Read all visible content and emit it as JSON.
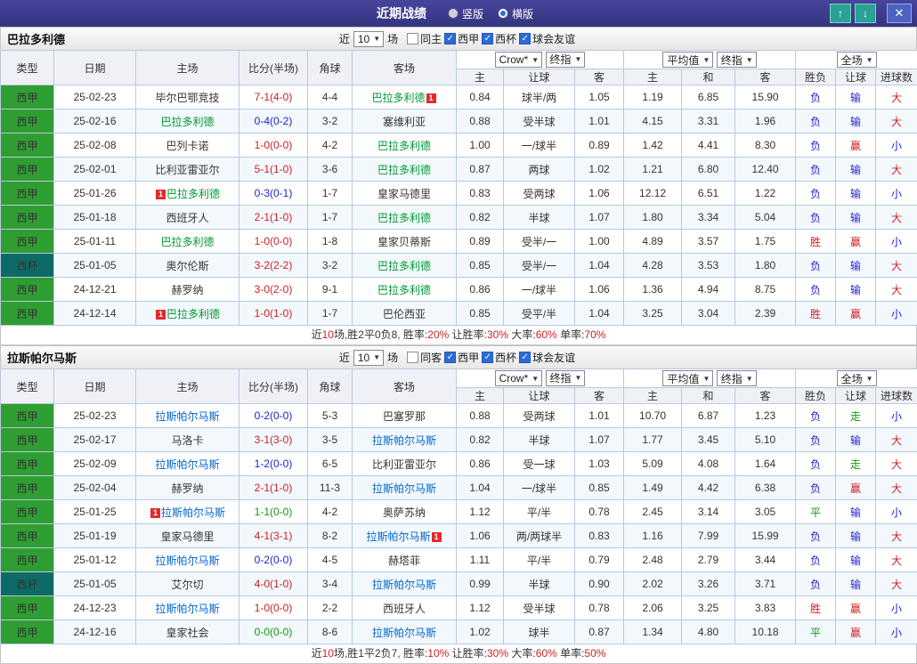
{
  "header": {
    "title": "近期战绩",
    "view_options": [
      {
        "label": "竖版",
        "checked": false
      },
      {
        "label": "横版",
        "checked": true
      }
    ],
    "up_icon": "↑",
    "down_icon": "↓",
    "close_icon": "✕"
  },
  "filter": {
    "prefix": "近",
    "count": "10",
    "suffix": "场"
  },
  "selects": {
    "bookmaker": "Crow*",
    "final": "终指",
    "average": "平均值",
    "scope": "全场"
  },
  "columns": {
    "type": "类型",
    "date": "日期",
    "home": "主场",
    "score": "比分(半场)",
    "corner": "角球",
    "away": "客场",
    "odds_home": "主",
    "odds_line": "让球",
    "odds_away": "客",
    "avg_home": "主",
    "avg_draw": "和",
    "avg_away": "客",
    "result": "胜负",
    "handicap": "让球",
    "goals": "进球数"
  },
  "badge": "1",
  "palette": {
    "r": "#cc2222",
    "b": "#2222cc",
    "g": "#119911",
    "k": "#333333"
  },
  "char_colors": {
    "胜": "r",
    "负": "b",
    "平": "g",
    "赢": "r",
    "输": "b",
    "走": "g",
    "大": "r",
    "小": "b"
  },
  "league_colors": {
    "西甲": "#2f9e32",
    "西杯": "#0d6b66"
  },
  "sections": [
    {
      "team": "巴拉多利德",
      "team_color": "#009933",
      "filters": [
        {
          "label": "同主",
          "checked": false
        },
        {
          "label": "西甲",
          "checked": true
        },
        {
          "label": "西杯",
          "checked": true
        },
        {
          "label": "球会友谊",
          "checked": true
        }
      ],
      "rows": [
        {
          "lg": "西甲",
          "date": "25-02-23",
          "home": "毕尔巴鄂竞技",
          "hf": false,
          "hb": false,
          "score": "7-1(4-0)",
          "sc": "r",
          "cn": "4-4",
          "away": "巴拉多利德",
          "af": true,
          "ab": true,
          "o1": "0.84",
          "ln": "球半/两",
          "o2": "1.05",
          "m1": "1.19",
          "m2": "6.85",
          "m3": "15.90",
          "rs": "负",
          "rh": "输",
          "rg": "大"
        },
        {
          "lg": "西甲",
          "date": "25-02-16",
          "home": "巴拉多利德",
          "hf": true,
          "hb": false,
          "score": "0-4(0-2)",
          "sc": "b",
          "cn": "3-2",
          "away": "塞维利亚",
          "af": false,
          "ab": false,
          "o1": "0.88",
          "ln": "受半球",
          "o2": "1.01",
          "m1": "4.15",
          "m2": "3.31",
          "m3": "1.96",
          "rs": "负",
          "rh": "输",
          "rg": "大"
        },
        {
          "lg": "西甲",
          "date": "25-02-08",
          "home": "巴列卡诺",
          "hf": false,
          "hb": false,
          "score": "1-0(0-0)",
          "sc": "r",
          "cn": "4-2",
          "away": "巴拉多利德",
          "af": true,
          "ab": false,
          "o1": "1.00",
          "ln": "一/球半",
          "o2": "0.89",
          "m1": "1.42",
          "m2": "4.41",
          "m3": "8.30",
          "rs": "负",
          "rh": "赢",
          "rg": "小"
        },
        {
          "lg": "西甲",
          "date": "25-02-01",
          "home": "比利亚雷亚尔",
          "hf": false,
          "hb": false,
          "score": "5-1(1-0)",
          "sc": "r",
          "cn": "3-6",
          "away": "巴拉多利德",
          "af": true,
          "ab": false,
          "o1": "0.87",
          "ln": "两球",
          "o2": "1.02",
          "m1": "1.21",
          "m2": "6.80",
          "m3": "12.40",
          "rs": "负",
          "rh": "输",
          "rg": "大"
        },
        {
          "lg": "西甲",
          "date": "25-01-26",
          "home": "巴拉多利德",
          "hf": true,
          "hb": true,
          "score": "0-3(0-1)",
          "sc": "b",
          "cn": "1-7",
          "away": "皇家马德里",
          "af": false,
          "ab": false,
          "o1": "0.83",
          "ln": "受两球",
          "o2": "1.06",
          "m1": "12.12",
          "m2": "6.51",
          "m3": "1.22",
          "rs": "负",
          "rh": "输",
          "rg": "小"
        },
        {
          "lg": "西甲",
          "date": "25-01-18",
          "home": "西班牙人",
          "hf": false,
          "hb": false,
          "score": "2-1(1-0)",
          "sc": "r",
          "cn": "1-7",
          "away": "巴拉多利德",
          "af": true,
          "ab": false,
          "o1": "0.82",
          "ln": "半球",
          "o2": "1.07",
          "m1": "1.80",
          "m2": "3.34",
          "m3": "5.04",
          "rs": "负",
          "rh": "输",
          "rg": "大"
        },
        {
          "lg": "西甲",
          "date": "25-01-11",
          "home": "巴拉多利德",
          "hf": true,
          "hb": false,
          "score": "1-0(0-0)",
          "sc": "r",
          "cn": "1-8",
          "away": "皇家贝蒂斯",
          "af": false,
          "ab": false,
          "o1": "0.89",
          "ln": "受半/一",
          "o2": "1.00",
          "m1": "4.89",
          "m2": "3.57",
          "m3": "1.75",
          "rs": "胜",
          "rh": "赢",
          "rg": "小"
        },
        {
          "lg": "西杯",
          "date": "25-01-05",
          "home": "奥尔伦斯",
          "hf": false,
          "hb": false,
          "score": "3-2(2-2)",
          "sc": "r",
          "cn": "3-2",
          "away": "巴拉多利德",
          "af": true,
          "ab": false,
          "o1": "0.85",
          "ln": "受半/一",
          "o2": "1.04",
          "m1": "4.28",
          "m2": "3.53",
          "m3": "1.80",
          "rs": "负",
          "rh": "输",
          "rg": "大"
        },
        {
          "lg": "西甲",
          "date": "24-12-21",
          "home": "赫罗纳",
          "hf": false,
          "hb": false,
          "score": "3-0(2-0)",
          "sc": "r",
          "cn": "9-1",
          "away": "巴拉多利德",
          "af": true,
          "ab": false,
          "o1": "0.86",
          "ln": "一/球半",
          "o2": "1.06",
          "m1": "1.36",
          "m2": "4.94",
          "m3": "8.75",
          "rs": "负",
          "rh": "输",
          "rg": "大"
        },
        {
          "lg": "西甲",
          "date": "24-12-14",
          "home": "巴拉多利德",
          "hf": true,
          "hb": true,
          "score": "1-0(1-0)",
          "sc": "r",
          "cn": "1-7",
          "away": "巴伦西亚",
          "af": false,
          "ab": false,
          "o1": "0.85",
          "ln": "受平/半",
          "o2": "1.04",
          "m1": "3.25",
          "m2": "3.04",
          "m3": "2.39",
          "rs": "胜",
          "rh": "赢",
          "rg": "小"
        }
      ],
      "summary": [
        [
          "近",
          "k"
        ],
        [
          "10",
          "r"
        ],
        [
          "场,胜2平0负8, 胜率:",
          "k"
        ],
        [
          "20%",
          "r"
        ],
        [
          " 让胜率:",
          "k"
        ],
        [
          "30%",
          "r"
        ],
        [
          " 大率:",
          "k"
        ],
        [
          "60%",
          "r"
        ],
        [
          " 单率:",
          "k"
        ],
        [
          "70%",
          "r"
        ]
      ]
    },
    {
      "team": "拉斯帕尔马斯",
      "team_color": "#0066cc",
      "filters": [
        {
          "label": "同客",
          "checked": false
        },
        {
          "label": "西甲",
          "checked": true
        },
        {
          "label": "西杯",
          "checked": true
        },
        {
          "label": "球会友谊",
          "checked": true
        }
      ],
      "rows": [
        {
          "lg": "西甲",
          "date": "25-02-23",
          "home": "拉斯帕尔马斯",
          "hf": true,
          "hb": false,
          "score": "0-2(0-0)",
          "sc": "b",
          "cn": "5-3",
          "away": "巴塞罗那",
          "af": false,
          "ab": false,
          "o1": "0.88",
          "ln": "受两球",
          "o2": "1.01",
          "m1": "10.70",
          "m2": "6.87",
          "m3": "1.23",
          "rs": "负",
          "rh": "走",
          "rg": "小"
        },
        {
          "lg": "西甲",
          "date": "25-02-17",
          "home": "马洛卡",
          "hf": false,
          "hb": false,
          "score": "3-1(3-0)",
          "sc": "r",
          "cn": "3-5",
          "away": "拉斯帕尔马斯",
          "af": true,
          "ab": false,
          "o1": "0.82",
          "ln": "半球",
          "o2": "1.07",
          "m1": "1.77",
          "m2": "3.45",
          "m3": "5.10",
          "rs": "负",
          "rh": "输",
          "rg": "大"
        },
        {
          "lg": "西甲",
          "date": "25-02-09",
          "home": "拉斯帕尔马斯",
          "hf": true,
          "hb": false,
          "score": "1-2(0-0)",
          "sc": "b",
          "cn": "6-5",
          "away": "比利亚雷亚尔",
          "af": false,
          "ab": false,
          "o1": "0.86",
          "ln": "受一球",
          "o2": "1.03",
          "m1": "5.09",
          "m2": "4.08",
          "m3": "1.64",
          "rs": "负",
          "rh": "走",
          "rg": "大"
        },
        {
          "lg": "西甲",
          "date": "25-02-04",
          "home": "赫罗纳",
          "hf": false,
          "hb": false,
          "score": "2-1(1-0)",
          "sc": "r",
          "cn": "11-3",
          "away": "拉斯帕尔马斯",
          "af": true,
          "ab": false,
          "o1": "1.04",
          "ln": "一/球半",
          "o2": "0.85",
          "m1": "1.49",
          "m2": "4.42",
          "m3": "6.38",
          "rs": "负",
          "rh": "赢",
          "rg": "大"
        },
        {
          "lg": "西甲",
          "date": "25-01-25",
          "home": "拉斯帕尔马斯",
          "hf": true,
          "hb": true,
          "score": "1-1(0-0)",
          "sc": "g",
          "cn": "4-2",
          "away": "奥萨苏纳",
          "af": false,
          "ab": false,
          "o1": "1.12",
          "ln": "平/半",
          "o2": "0.78",
          "m1": "2.45",
          "m2": "3.14",
          "m3": "3.05",
          "rs": "平",
          "rh": "输",
          "rg": "小"
        },
        {
          "lg": "西甲",
          "date": "25-01-19",
          "home": "皇家马德里",
          "hf": false,
          "hb": false,
          "score": "4-1(3-1)",
          "sc": "r",
          "cn": "8-2",
          "away": "拉斯帕尔马斯",
          "af": true,
          "ab": true,
          "o1": "1.06",
          "ln": "两/两球半",
          "o2": "0.83",
          "m1": "1.16",
          "m2": "7.99",
          "m3": "15.99",
          "rs": "负",
          "rh": "输",
          "rg": "大"
        },
        {
          "lg": "西甲",
          "date": "25-01-12",
          "home": "拉斯帕尔马斯",
          "hf": true,
          "hb": false,
          "score": "0-2(0-0)",
          "sc": "b",
          "cn": "4-5",
          "away": "赫塔菲",
          "af": false,
          "ab": false,
          "o1": "1.11",
          "ln": "平/半",
          "o2": "0.79",
          "m1": "2.48",
          "m2": "2.79",
          "m3": "3.44",
          "rs": "负",
          "rh": "输",
          "rg": "大"
        },
        {
          "lg": "西杯",
          "date": "25-01-05",
          "home": "艾尔切",
          "hf": false,
          "hb": false,
          "score": "4-0(1-0)",
          "sc": "r",
          "cn": "3-4",
          "away": "拉斯帕尔马斯",
          "af": true,
          "ab": false,
          "o1": "0.99",
          "ln": "半球",
          "o2": "0.90",
          "m1": "2.02",
          "m2": "3.26",
          "m3": "3.71",
          "rs": "负",
          "rh": "输",
          "rg": "大"
        },
        {
          "lg": "西甲",
          "date": "24-12-23",
          "home": "拉斯帕尔马斯",
          "hf": true,
          "hb": false,
          "score": "1-0(0-0)",
          "sc": "r",
          "cn": "2-2",
          "away": "西班牙人",
          "af": false,
          "ab": false,
          "o1": "1.12",
          "ln": "受半球",
          "o2": "0.78",
          "m1": "2.06",
          "m2": "3.25",
          "m3": "3.83",
          "rs": "胜",
          "rh": "赢",
          "rg": "小"
        },
        {
          "lg": "西甲",
          "date": "24-12-16",
          "home": "皇家社会",
          "hf": false,
          "hb": false,
          "score": "0-0(0-0)",
          "sc": "g",
          "cn": "8-6",
          "away": "拉斯帕尔马斯",
          "af": true,
          "ab": false,
          "o1": "1.02",
          "ln": "球半",
          "o2": "0.87",
          "m1": "1.34",
          "m2": "4.80",
          "m3": "10.18",
          "rs": "平",
          "rh": "赢",
          "rg": "小"
        }
      ],
      "summary": [
        [
          "近",
          "k"
        ],
        [
          "10",
          "r"
        ],
        [
          "场,胜1平2负7, 胜率:",
          "k"
        ],
        [
          "10%",
          "r"
        ],
        [
          " 让胜率:",
          "k"
        ],
        [
          "30%",
          "r"
        ],
        [
          " 大率:",
          "k"
        ],
        [
          "60%",
          "r"
        ],
        [
          " 单率:",
          "k"
        ],
        [
          "50%",
          "r"
        ]
      ]
    }
  ]
}
